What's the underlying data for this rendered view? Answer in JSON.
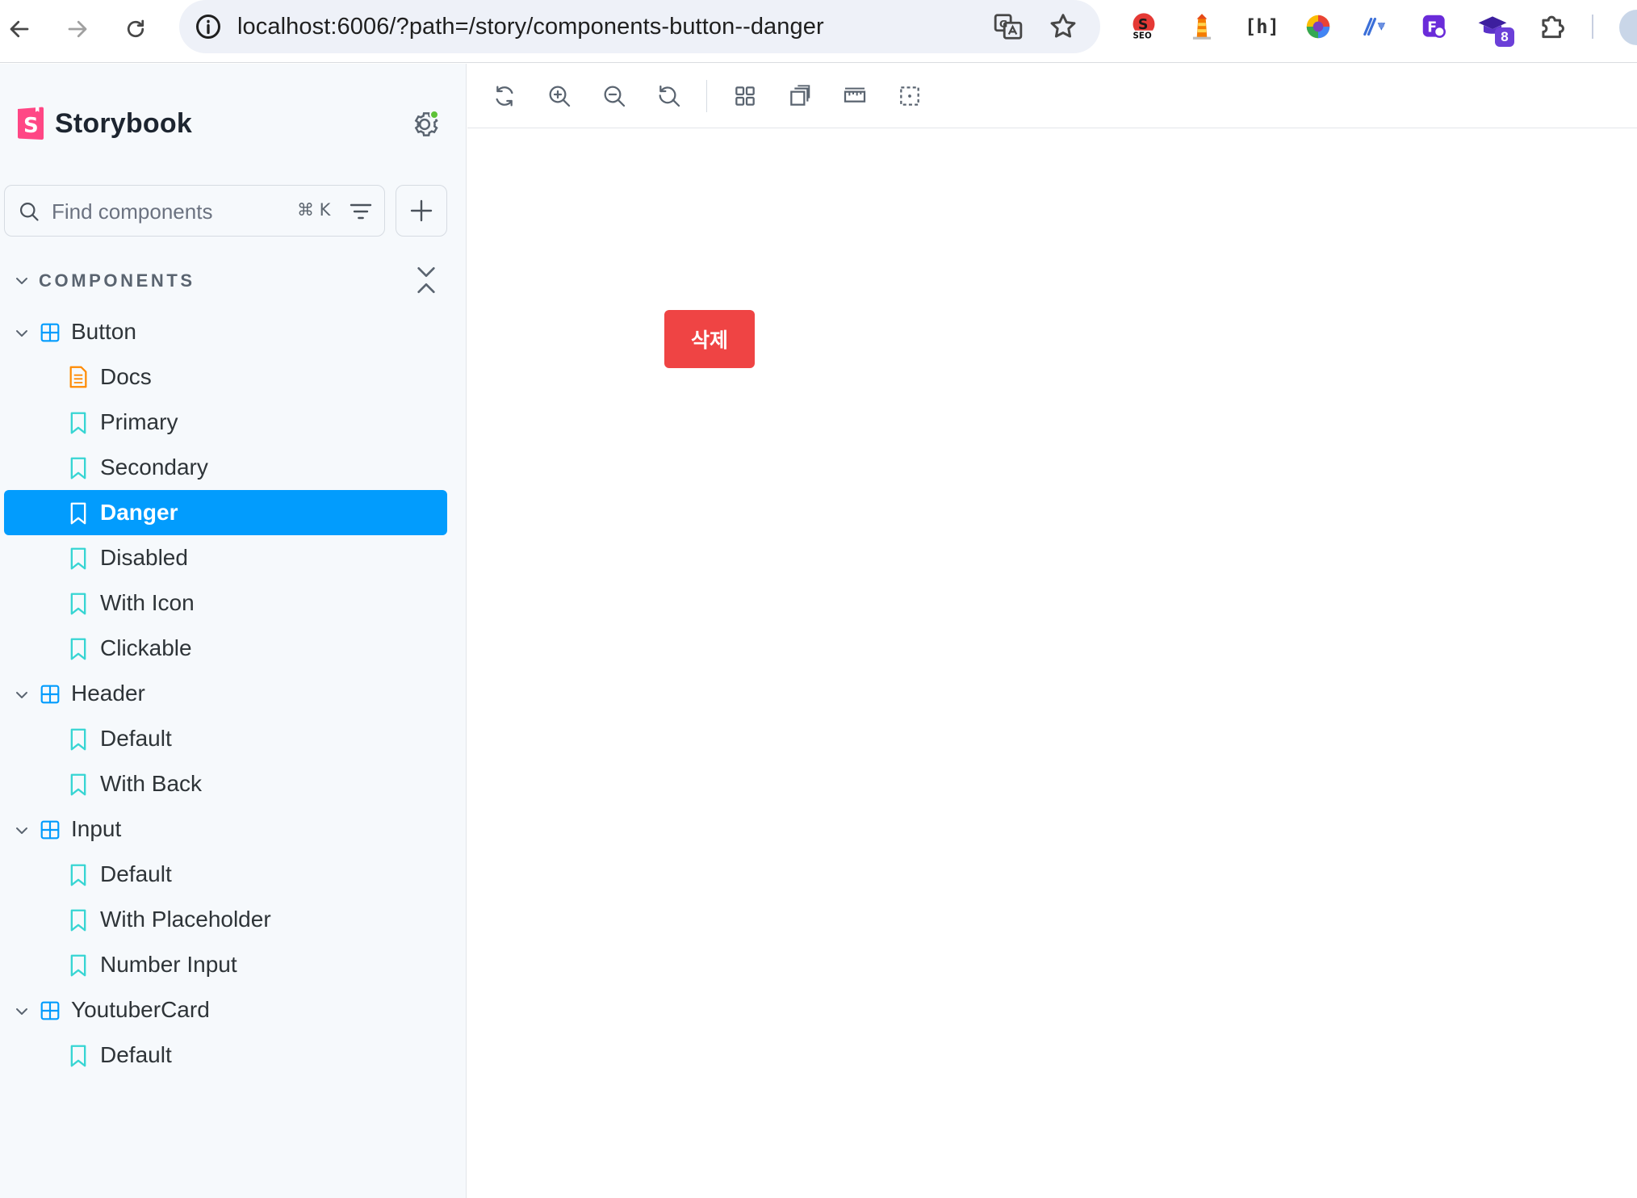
{
  "browser": {
    "url": "localhost:6006/?path=/story/components-button--danger",
    "extension_badge": "8",
    "extensions": [
      "seo-icon",
      "lighthouse-icon",
      "hotjar-icon",
      "color-picker-icon",
      "vue-devtools-icon",
      "fontfinder-icon",
      "graduation-cap-icon",
      "puzzle-icon"
    ]
  },
  "sidebar": {
    "brand": "Storybook",
    "search": {
      "placeholder": "Find components",
      "shortcut": "⌘ K"
    },
    "section": "COMPONENTS",
    "groups": [
      {
        "label": "Button",
        "stories": [
          {
            "label": "Docs",
            "kind": "docs"
          },
          {
            "label": "Primary",
            "kind": "story"
          },
          {
            "label": "Secondary",
            "kind": "story"
          },
          {
            "label": "Danger",
            "kind": "story",
            "selected": true
          },
          {
            "label": "Disabled",
            "kind": "story"
          },
          {
            "label": "With Icon",
            "kind": "story"
          },
          {
            "label": "Clickable",
            "kind": "story"
          }
        ]
      },
      {
        "label": "Header",
        "stories": [
          {
            "label": "Default",
            "kind": "story"
          },
          {
            "label": "With Back",
            "kind": "story"
          }
        ]
      },
      {
        "label": "Input",
        "stories": [
          {
            "label": "Default",
            "kind": "story"
          },
          {
            "label": "With Placeholder",
            "kind": "story"
          },
          {
            "label": "Number Input",
            "kind": "story"
          }
        ]
      },
      {
        "label": "YoutuberCard",
        "stories": [
          {
            "label": "Default",
            "kind": "story"
          }
        ]
      }
    ]
  },
  "toolbar": {
    "tools": [
      "remount-icon",
      "zoom-in-icon",
      "zoom-out-icon",
      "reset-zoom-icon",
      "grid-icon",
      "background-icon",
      "measure-icon",
      "outline-icon"
    ]
  },
  "preview": {
    "button_label": "삭제",
    "button_color": "#ef4444"
  },
  "colors": {
    "selected": "#029cfd",
    "brand": "#ff4785",
    "story_icon": "#37d5d3",
    "group_icon": "#029cfd",
    "docs_icon": "#ff8a00"
  }
}
